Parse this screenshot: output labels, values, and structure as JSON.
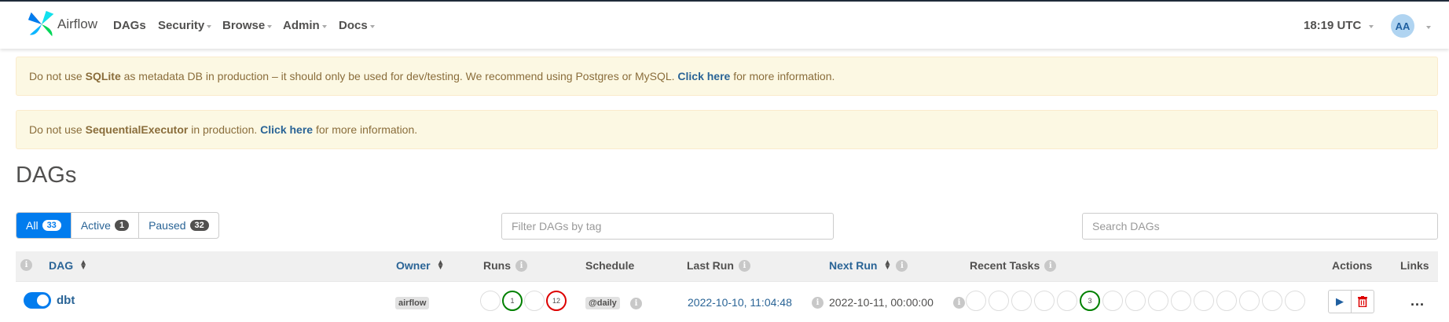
{
  "navbar": {
    "brand": "Airflow",
    "items": [
      "DAGs",
      "Security",
      "Browse",
      "Admin",
      "Docs"
    ],
    "clock": "18:19 UTC",
    "avatar": "AA"
  },
  "alerts": [
    {
      "pre": "Do not use ",
      "strong": "SQLite",
      "mid": " as metadata DB in production – it should only be used for dev/testing. We recommend using Postgres or MySQL. ",
      "link": "Click here",
      "post": " for more information."
    },
    {
      "pre": "Do not use ",
      "strong": "SequentialExecutor",
      "mid": " in production. ",
      "link": "Click here",
      "post": " for more information."
    }
  ],
  "page_title": "DAGs",
  "tabs": [
    {
      "label": "All",
      "count": "33"
    },
    {
      "label": "Active",
      "count": "1"
    },
    {
      "label": "Paused",
      "count": "32"
    }
  ],
  "filters": {
    "tag_placeholder": "Filter DAGs by tag",
    "search_placeholder": "Search DAGs"
  },
  "table": {
    "info_glyph": "i",
    "headers": {
      "dag": "DAG",
      "owner": "Owner",
      "runs": "Runs",
      "schedule": "Schedule",
      "last_run": "Last Run",
      "next_run": "Next Run",
      "recent_tasks": "Recent Tasks",
      "actions": "Actions",
      "links": "Links"
    },
    "rows": [
      {
        "dag": "dbt",
        "active": true,
        "owner": "airflow",
        "runs": [
          "",
          "1",
          "",
          "12"
        ],
        "run_states": [
          "none",
          "success",
          "none",
          "failed"
        ],
        "schedule": "@daily",
        "last_run": "2022-10-10, 11:04:48",
        "next_run": "2022-10-11, 00:00:00",
        "recent_tasks": [
          "",
          "",
          "",
          "",
          "",
          "3",
          "",
          "",
          "",
          "",
          "",
          "",
          "",
          "",
          ""
        ],
        "recent_task_states": [
          "none",
          "none",
          "none",
          "none",
          "none",
          "success",
          "none",
          "none",
          "none",
          "none",
          "none",
          "none",
          "none",
          "none",
          "none"
        ],
        "links": "..."
      }
    ]
  },
  "colors": {
    "accent": "#017cee",
    "link": "#2a6496",
    "success": "#008000",
    "failed": "#dd0000",
    "alert_bg": "#fcf8e3"
  }
}
